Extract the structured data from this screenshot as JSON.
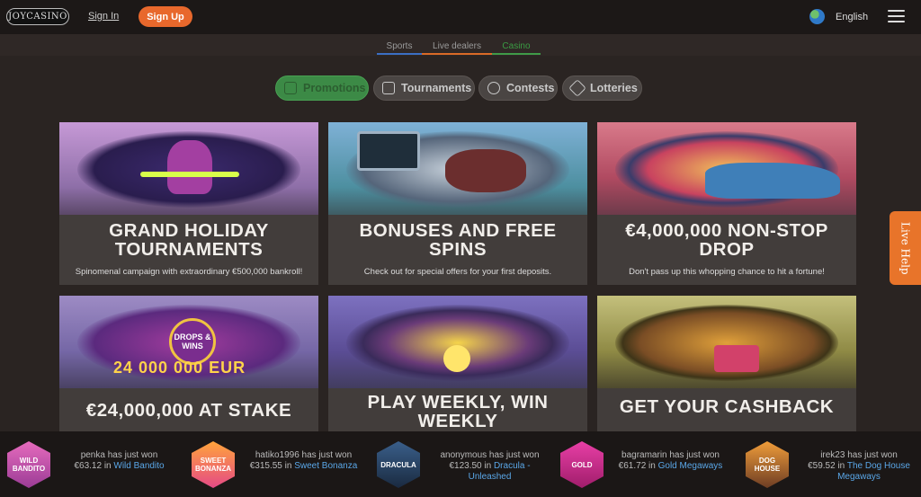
{
  "header": {
    "logo": "JOYCASINO",
    "sign_in": "Sign In",
    "sign_up": "Sign Up",
    "language": "English",
    "menu_icon": "hamburger-menu-icon",
    "globe_icon": "globe-icon"
  },
  "subtabs": [
    {
      "label": "Sports",
      "color": "#3b6fc4"
    },
    {
      "label": "Live dealers",
      "color": "#d96a27"
    },
    {
      "label": "Casino",
      "color": "#3f9b48",
      "active": true
    }
  ],
  "pills": [
    {
      "label": "Promotions",
      "icon": "gift-icon",
      "active": true
    },
    {
      "label": "Tournaments",
      "icon": "trophy-icon"
    },
    {
      "label": "Contests",
      "icon": "medal-icon"
    },
    {
      "label": "Lotteries",
      "icon": "ticket-icon"
    }
  ],
  "cards": [
    {
      "title": "GRAND HOLIDAY TOURNAMENTS",
      "text": "Spinomenal campaign with extraordinary €500,000 bankroll!"
    },
    {
      "title": "BONUSES AND FREE SPINS",
      "text": "Check out for special offers for your first deposits."
    },
    {
      "title": "€4,000,000 NON-STOP DROP",
      "text": "Don't pass up this whopping chance to hit a fortune!"
    },
    {
      "title": "€24,000,000 AT STAKE",
      "badge": "DROPS & WINS",
      "jackpot": "24 000 000 EUR"
    },
    {
      "title": "PLAY WEEKLY, WIN WEEKLY"
    },
    {
      "title": "GET YOUR CASHBACK"
    }
  ],
  "live_help": "Live Help",
  "winners": [
    {
      "text": "penka has just won",
      "amount": "€63.12 in",
      "game": "Wild Bandito",
      "badge": "WILD BANDITO"
    },
    {
      "text": "hatiko1996 has just won",
      "amount": "€315.55 in",
      "game": "Sweet Bonanza",
      "badge": "SWEET BONANZA"
    },
    {
      "text": "anonymous has just won",
      "amount": "€123.50 in",
      "game": "Dracula - Unleashed",
      "badge": "DRACULA"
    },
    {
      "text": "bagramarin has just won",
      "amount": "€61.72 in",
      "game": "Gold Megaways",
      "badge": "GOLD"
    },
    {
      "text": "irek23 has just won",
      "amount": "€59.52 in",
      "game": "The Dog House Megaways",
      "badge": "DOG HOUSE"
    }
  ]
}
